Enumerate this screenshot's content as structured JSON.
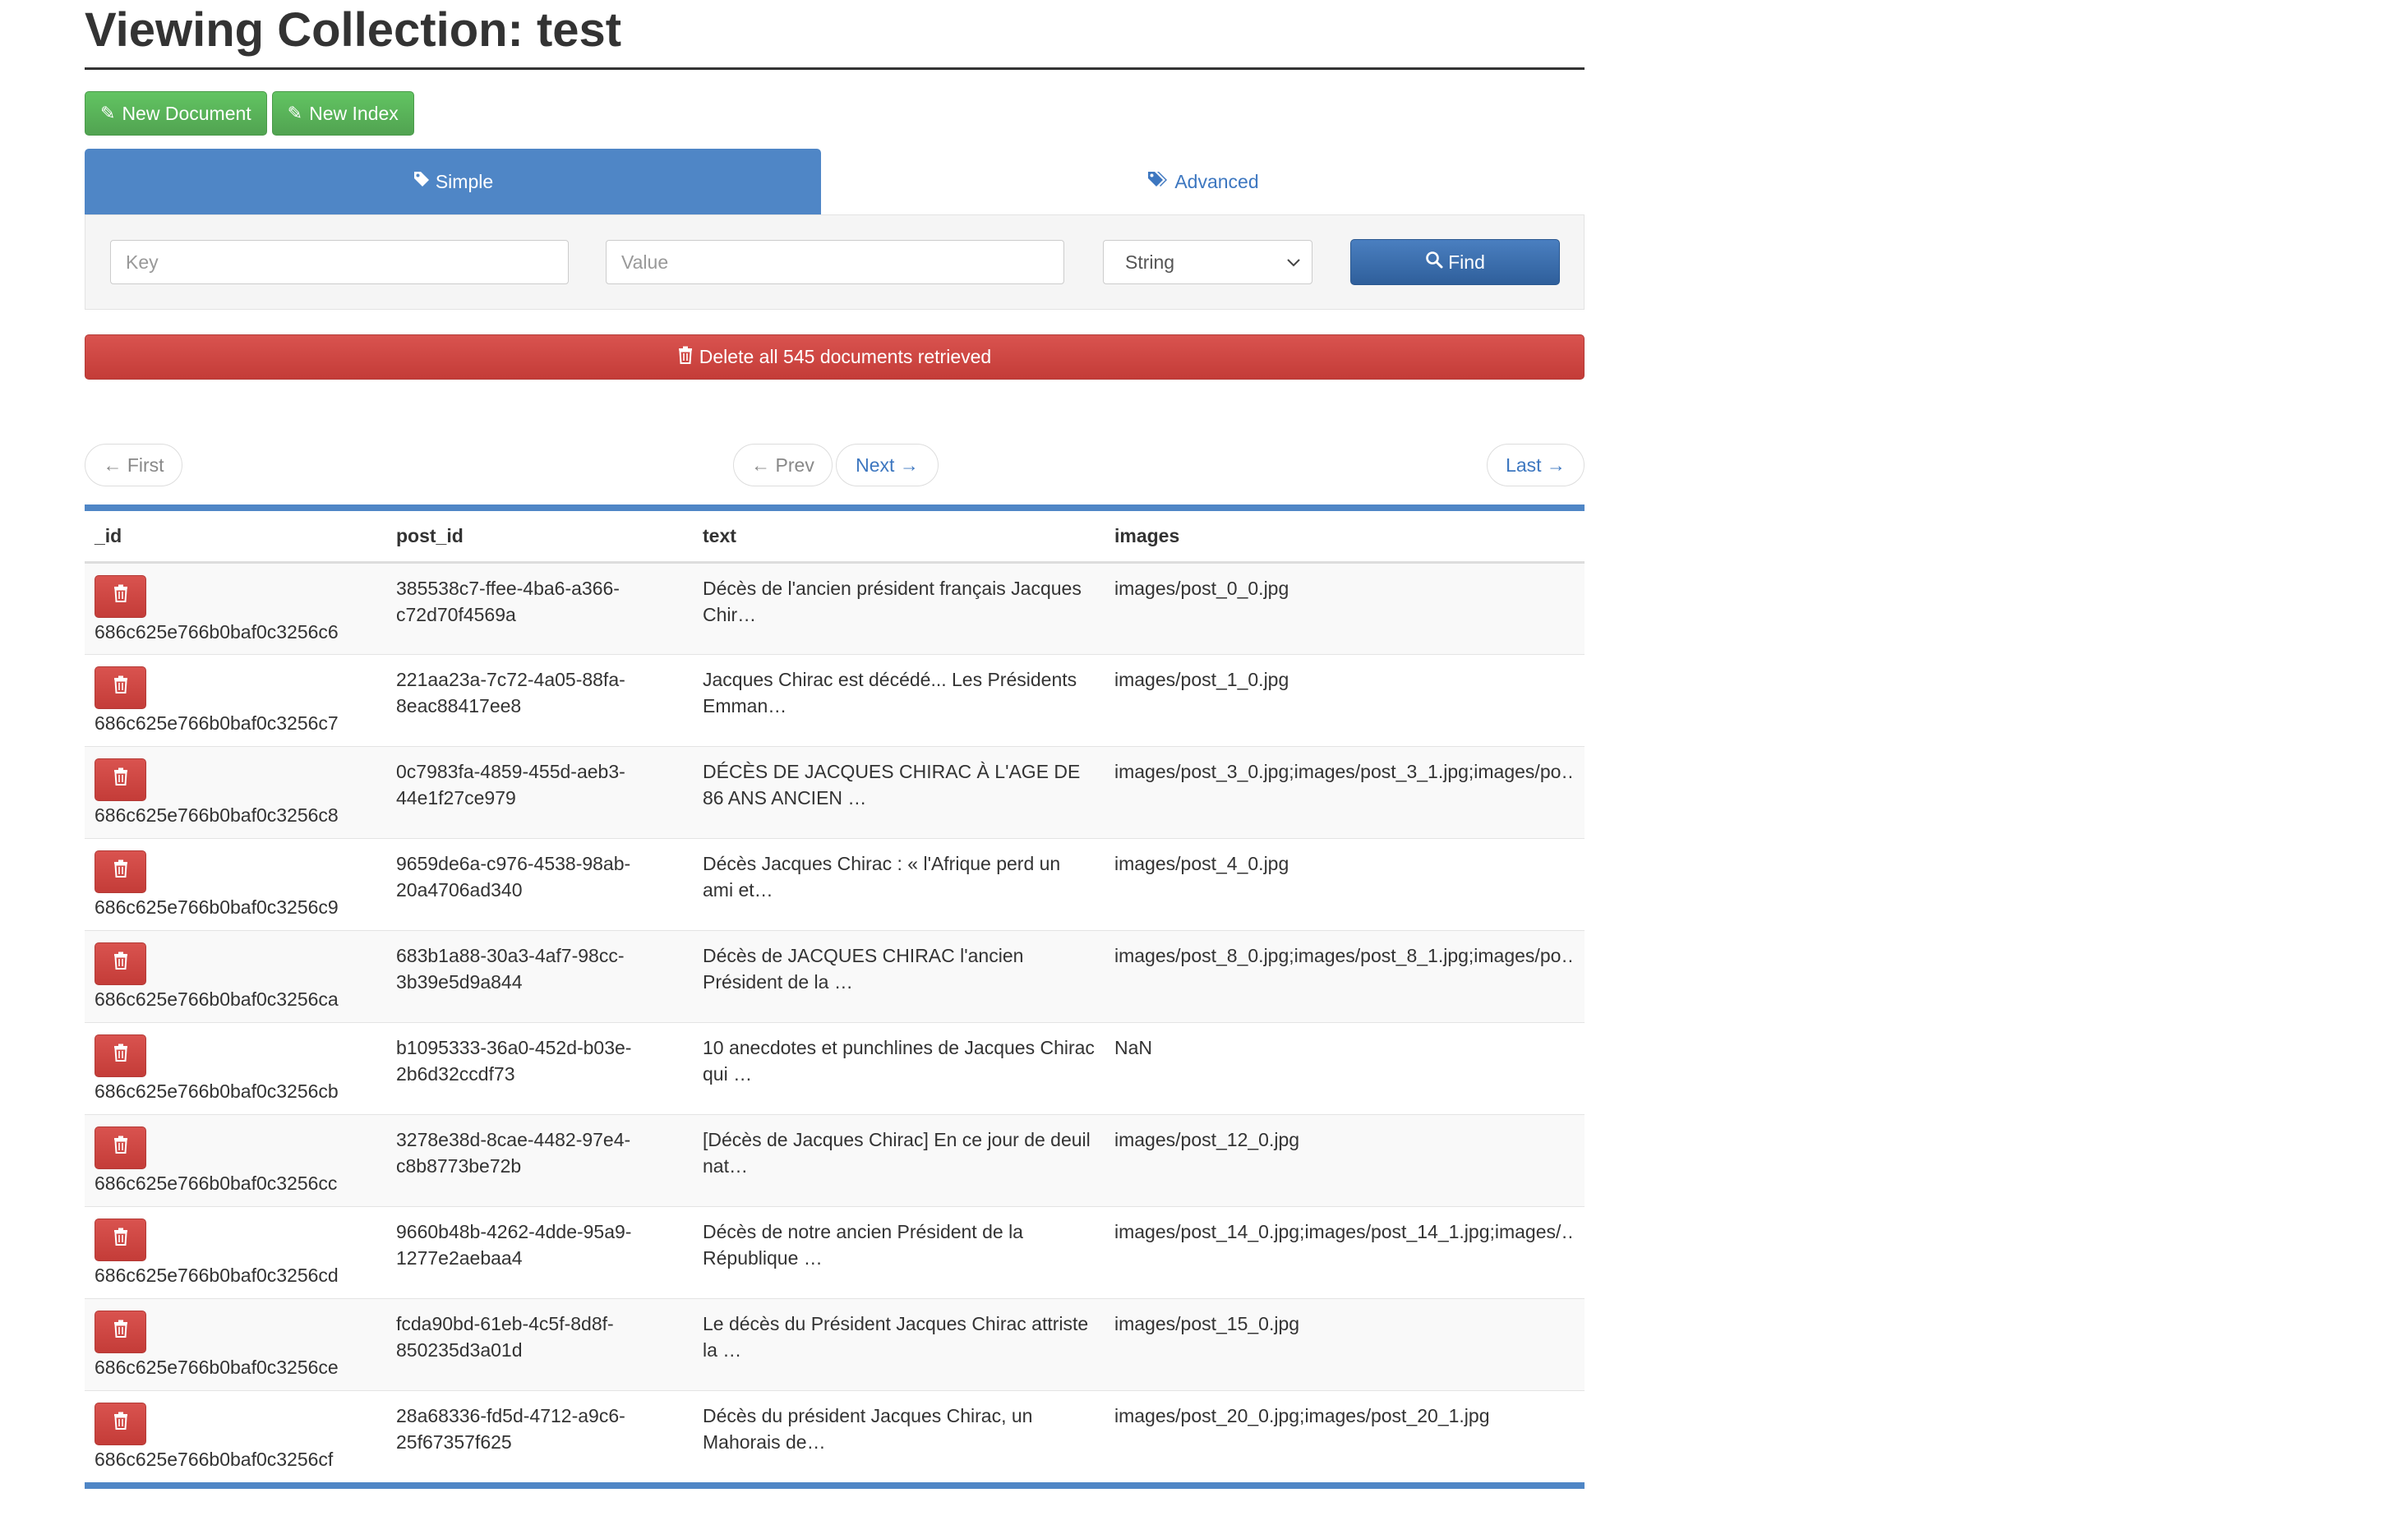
{
  "page": {
    "title": "Viewing Collection: test"
  },
  "actions": {
    "new_document": "New Document",
    "new_index": "New Index"
  },
  "tabs": [
    {
      "label": "Simple"
    },
    {
      "label": "Advanced"
    }
  ],
  "search": {
    "key_placeholder": "Key",
    "value_placeholder": "Value",
    "type_selected": "String",
    "find_label": "Find"
  },
  "delete_all_label": "Delete all 545 documents retrieved",
  "pager": {
    "first": "← First",
    "prev": "← Prev",
    "next": "Next →",
    "last": "Last →"
  },
  "table": {
    "headers": [
      "_id",
      "post_id",
      "text",
      "images"
    ],
    "rows": [
      {
        "id": "686c625e766b0baf0c3256c6",
        "post_id": "385538c7-ffee-4ba6-a366-c72d70f4569a",
        "text": "Décès de l'ancien président français Jacques Chir…",
        "images": "images/post_0_0.jpg"
      },
      {
        "id": "686c625e766b0baf0c3256c7",
        "post_id": "221aa23a-7c72-4a05-88fa-8eac88417ee8",
        "text": "Jacques Chirac est décédé... Les Présidents Emman…",
        "images": "images/post_1_0.jpg"
      },
      {
        "id": "686c625e766b0baf0c3256c8",
        "post_id": "0c7983fa-4859-455d-aeb3-44e1f27ce979",
        "text": "DÉCÈS DE JACQUES CHIRAC À L'AGE DE 86 ANS ANCIEN …",
        "images": "images/post_3_0.jpg;images/post_3_1.jpg;images/po…"
      },
      {
        "id": "686c625e766b0baf0c3256c9",
        "post_id": "9659de6a-c976-4538-98ab-20a4706ad340",
        "text": "Décès Jacques Chirac : « l'Afrique perd un ami et…",
        "images": "images/post_4_0.jpg"
      },
      {
        "id": "686c625e766b0baf0c3256ca",
        "post_id": "683b1a88-30a3-4af7-98cc-3b39e5d9a844",
        "text": "Décès de JACQUES CHIRAC l'ancien Président de la …",
        "images": "images/post_8_0.jpg;images/post_8_1.jpg;images/po…"
      },
      {
        "id": "686c625e766b0baf0c3256cb",
        "post_id": "b1095333-36a0-452d-b03e-2b6d32ccdf73",
        "text": "10 anecdotes et punchlines de Jacques Chirac qui …",
        "images": "NaN"
      },
      {
        "id": "686c625e766b0baf0c3256cc",
        "post_id": "3278e38d-8cae-4482-97e4-c8b8773be72b",
        "text": "[Décès de Jacques Chirac] En ce jour de deuil nat…",
        "images": "images/post_12_0.jpg"
      },
      {
        "id": "686c625e766b0baf0c3256cd",
        "post_id": "9660b48b-4262-4dde-95a9-1277e2aebaa4",
        "text": "Décès de notre ancien Président de la République …",
        "images": "images/post_14_0.jpg;images/post_14_1.jpg;images/…"
      },
      {
        "id": "686c625e766b0baf0c3256ce",
        "post_id": "fcda90bd-61eb-4c5f-8d8f-850235d3a01d",
        "text": "Le décès du Président Jacques Chirac attriste la …",
        "images": "images/post_15_0.jpg"
      },
      {
        "id": "686c625e766b0baf0c3256cf",
        "post_id": "28a68336-fd5d-4712-a9c6-25f67357f625",
        "text": "Décès du président Jacques Chirac, un Mahorais de…",
        "images": "images/post_20_0.jpg;images/post_20_1.jpg"
      }
    ]
  },
  "icons": {
    "pencil": "pencil-icon",
    "tag": "tag-icon",
    "tags": "tags-icon",
    "search": "search-icon",
    "trash": "trash-icon",
    "chevron": "chevron-down-icon"
  },
  "colors": {
    "primary": "#4f86c6",
    "success": "#5cb85c",
    "danger": "#d9534f",
    "link": "#3d77c0"
  }
}
